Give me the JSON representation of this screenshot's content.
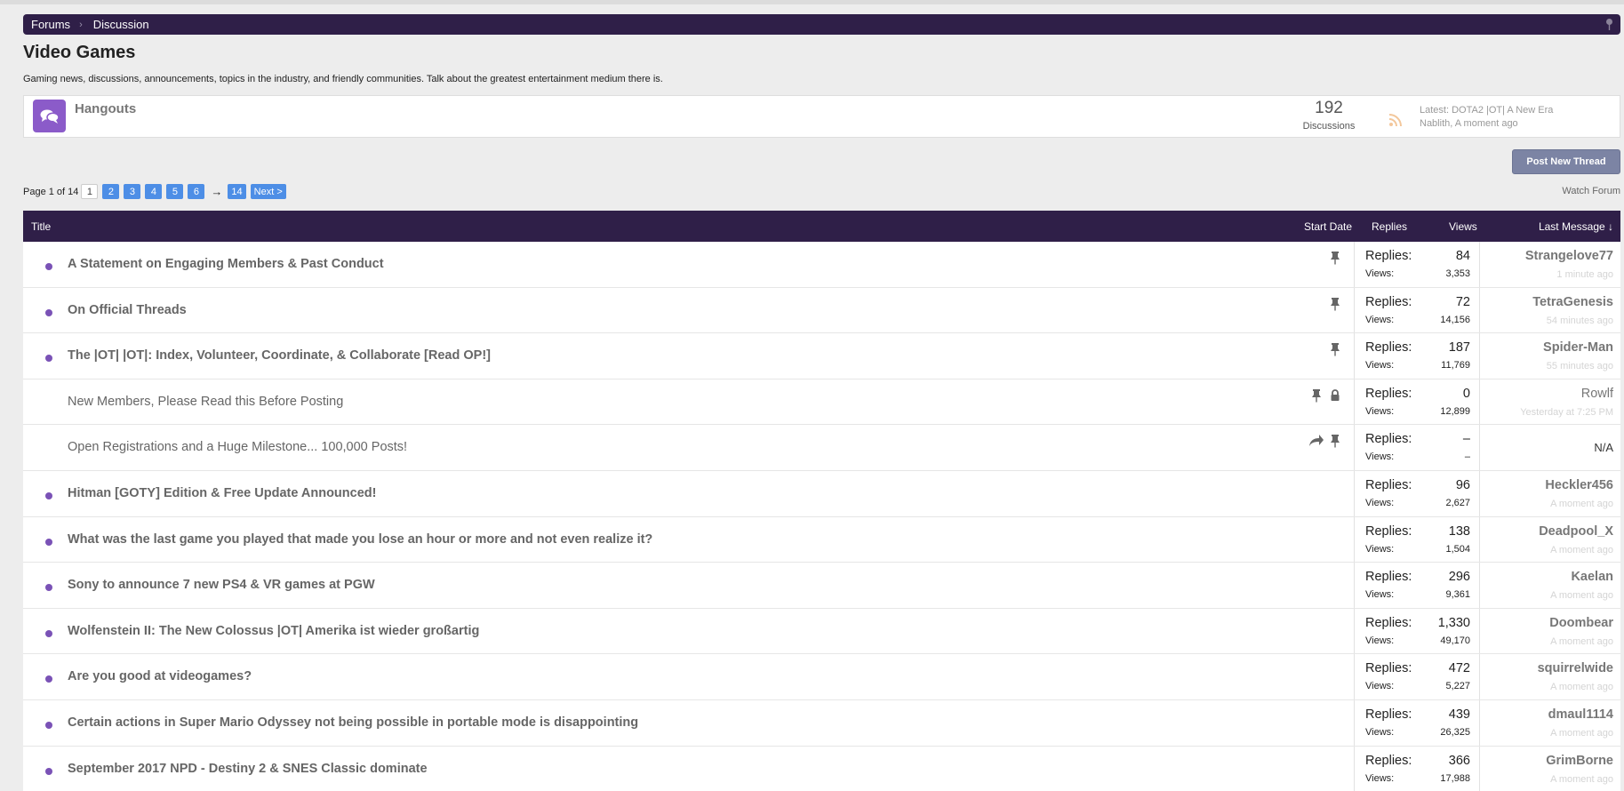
{
  "breadcrumb": {
    "items": [
      "Forums",
      "Discussion"
    ],
    "separator": "›"
  },
  "page": {
    "title": "Video Games",
    "description": "Gaming news, discussions, announcements, topics in the industry, and friendly communities. Talk about the greatest entertainment medium there is."
  },
  "subforum": {
    "name": "Hangouts",
    "count": "192",
    "count_label": "Discussions",
    "latest": "Latest: DOTA2 |OT| A New Era",
    "latest_by": "Nablith, A moment ago"
  },
  "actions": {
    "post_new_thread": "Post New Thread",
    "watch_forum": "Watch Forum"
  },
  "pagination": {
    "label": "Page 1 of 14",
    "current": "1",
    "pages": [
      "2",
      "3",
      "4",
      "5",
      "6"
    ],
    "arrow": "→",
    "last": "14",
    "next": "Next >"
  },
  "table": {
    "headers": {
      "title": "Title",
      "start_date": "Start Date",
      "replies": "Replies",
      "views": "Views",
      "last_message": "Last Message ↓"
    },
    "replies_label": "Replies:",
    "views_label": "Views:",
    "rows": [
      {
        "title": "A Statement on Engaging Members & Past Conduct",
        "replies": "84",
        "views": "3,353",
        "last_user": "Strangelove77",
        "last_time": "1 minute ago"
      },
      {
        "title": "On Official Threads",
        "replies": "72",
        "views": "14,156",
        "last_user": "TetraGenesis",
        "last_time": "54 minutes ago"
      },
      {
        "title": "The |OT| |OT|: Index, Volunteer, Coordinate, & Collaborate [Read OP!]",
        "replies": "187",
        "views": "11,769",
        "last_user": "Spider-Man",
        "last_time": "55 minutes ago"
      },
      {
        "title": "New Members, Please Read this Before Posting",
        "replies": "0",
        "views": "12,899",
        "last_user": "Rowlf",
        "last_time": "Yesterday at 7:25 PM"
      },
      {
        "title": "Open Registrations and a Huge Milestone... 100,000 Posts!",
        "replies": "–",
        "views": "–",
        "last_na": "N/A"
      },
      {
        "title": "Hitman [GOTY] Edition & Free Update Announced!",
        "replies": "96",
        "views": "2,627",
        "last_user": "Heckler456",
        "last_time": "A moment ago"
      },
      {
        "title": "What was the last game you played that made you lose an hour or more and not even realize it?",
        "replies": "138",
        "views": "1,504",
        "last_user": "Deadpool_X",
        "last_time": "A moment ago"
      },
      {
        "title": "Sony to announce 7 new PS4 & VR games at PGW",
        "replies": "296",
        "views": "9,361",
        "last_user": "Kaelan",
        "last_time": "A moment ago"
      },
      {
        "title": "Wolfenstein II: The New Colossus |OT| Amerika ist wieder großartig",
        "replies": "1,330",
        "views": "49,170",
        "last_user": "Doombear",
        "last_time": "A moment ago"
      },
      {
        "title": "Are you good at videogames?",
        "replies": "472",
        "views": "5,227",
        "last_user": "squirrelwide",
        "last_time": "A moment ago"
      },
      {
        "title": "Certain actions in Super Mario Odyssey not being possible in portable mode is disappointing",
        "replies": "439",
        "views": "26,325",
        "last_user": "dmaul1114",
        "last_time": "A moment ago"
      },
      {
        "title": "September 2017 NPD - Destiny 2 & SNES Classic dominate",
        "replies": "366",
        "views": "17,988",
        "last_user": "GrimBorne",
        "last_time": "A moment ago"
      }
    ]
  },
  "colors": {
    "header_bg": "#2f1f48",
    "accent_purple": "#8b5bc9",
    "page_button": "#4d8ee6"
  }
}
